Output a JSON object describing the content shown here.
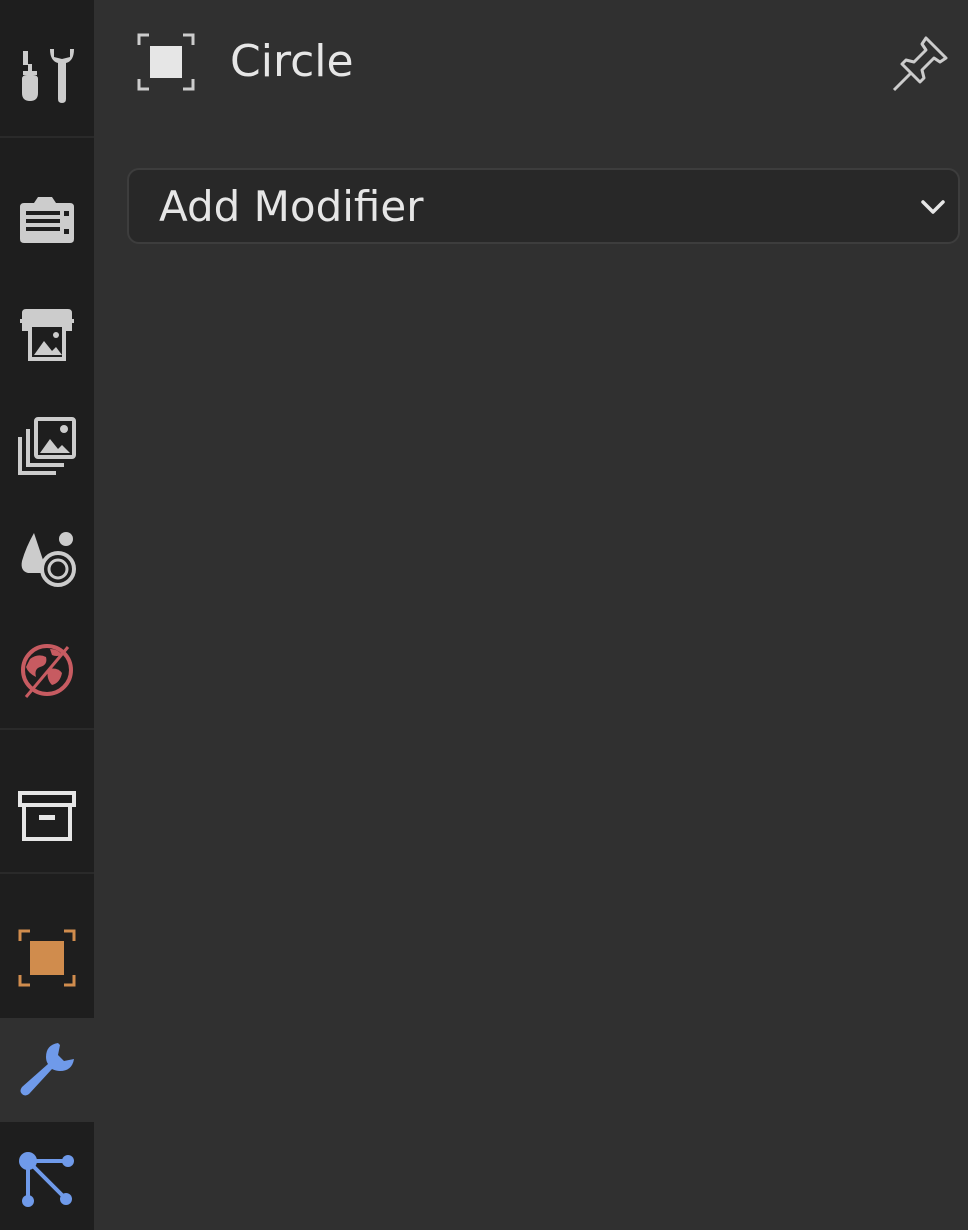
{
  "panel": {
    "object_name": "Circle",
    "add_modifier_label": "Add Modifier"
  },
  "tabs": [
    {
      "name": "tool",
      "icon": "tool-icon",
      "active": false
    },
    {
      "name": "render",
      "icon": "render-camera-icon",
      "active": false
    },
    {
      "name": "output",
      "icon": "output-printer-icon",
      "active": false
    },
    {
      "name": "view-layer",
      "icon": "view-layer-images-icon",
      "active": false
    },
    {
      "name": "scene",
      "icon": "scene-icon",
      "active": false
    },
    {
      "name": "world",
      "icon": "world-icon",
      "active": false
    },
    {
      "name": "collection",
      "icon": "collection-box-icon",
      "active": false
    },
    {
      "name": "object",
      "icon": "object-icon",
      "active": false
    },
    {
      "name": "modifiers",
      "icon": "wrench-icon",
      "active": true
    },
    {
      "name": "object-data",
      "icon": "curve-data-icon",
      "active": false
    }
  ],
  "colors": {
    "background": "#303030",
    "tabbar": "#1e1e1e",
    "icon_gray": "#cccccc",
    "world_red": "#c75b61",
    "object_orange": "#d08c4d",
    "modifier_blue": "#6f9aea",
    "data_blue": "#6f9aea",
    "text": "#e6e6e6"
  }
}
